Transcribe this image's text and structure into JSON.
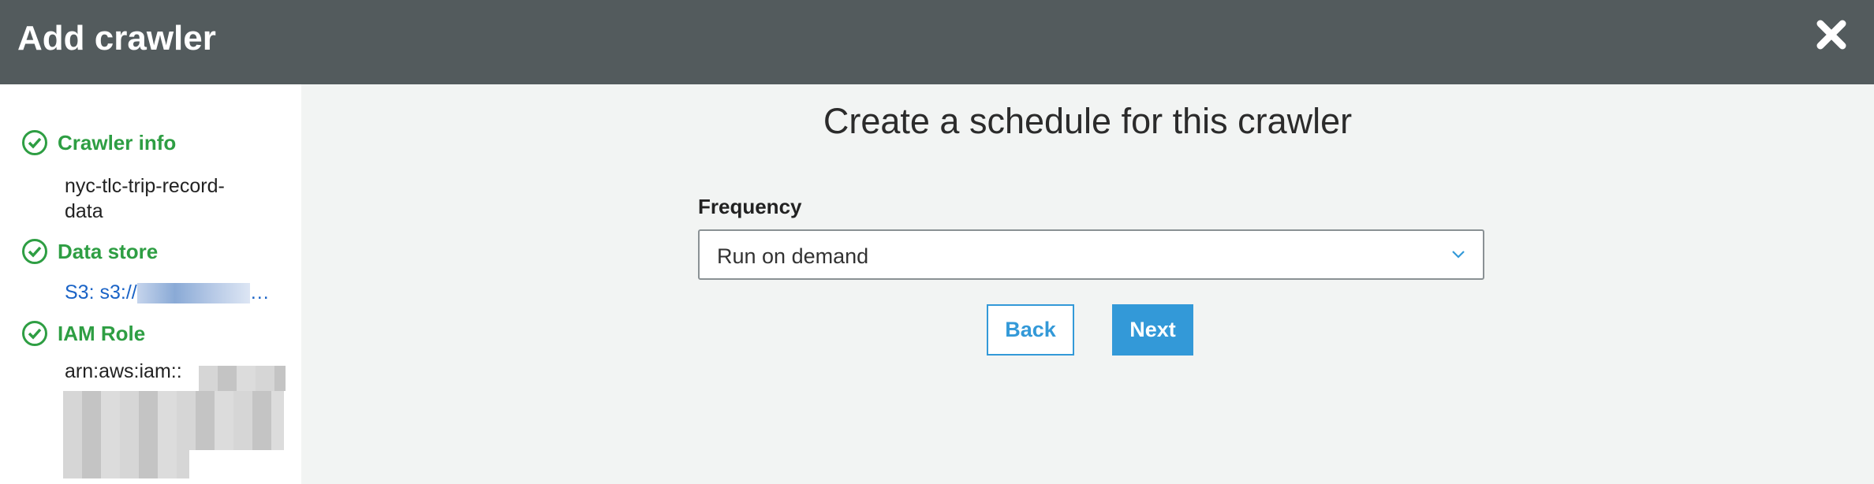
{
  "header": {
    "title": "Add crawler",
    "close_icon": "close-icon"
  },
  "sidebar": {
    "steps": [
      {
        "label": "Crawler info",
        "value_lines": [
          "nyc-tlc-trip-record-",
          "data"
        ]
      },
      {
        "label": "Data store",
        "value": "S3: s3://",
        "ellipsis": "…"
      },
      {
        "label": "IAM Role",
        "value": "arn:aws:iam::"
      }
    ],
    "accent": "#2e9e43"
  },
  "main": {
    "title": "Create a schedule for this crawler",
    "frequency_label": "Frequency",
    "frequency_value": "Run on demand",
    "back_label": "Back",
    "next_label": "Next"
  },
  "colors": {
    "header": "#535b5d",
    "primary": "#3399d8",
    "link": "#1a63c6"
  }
}
